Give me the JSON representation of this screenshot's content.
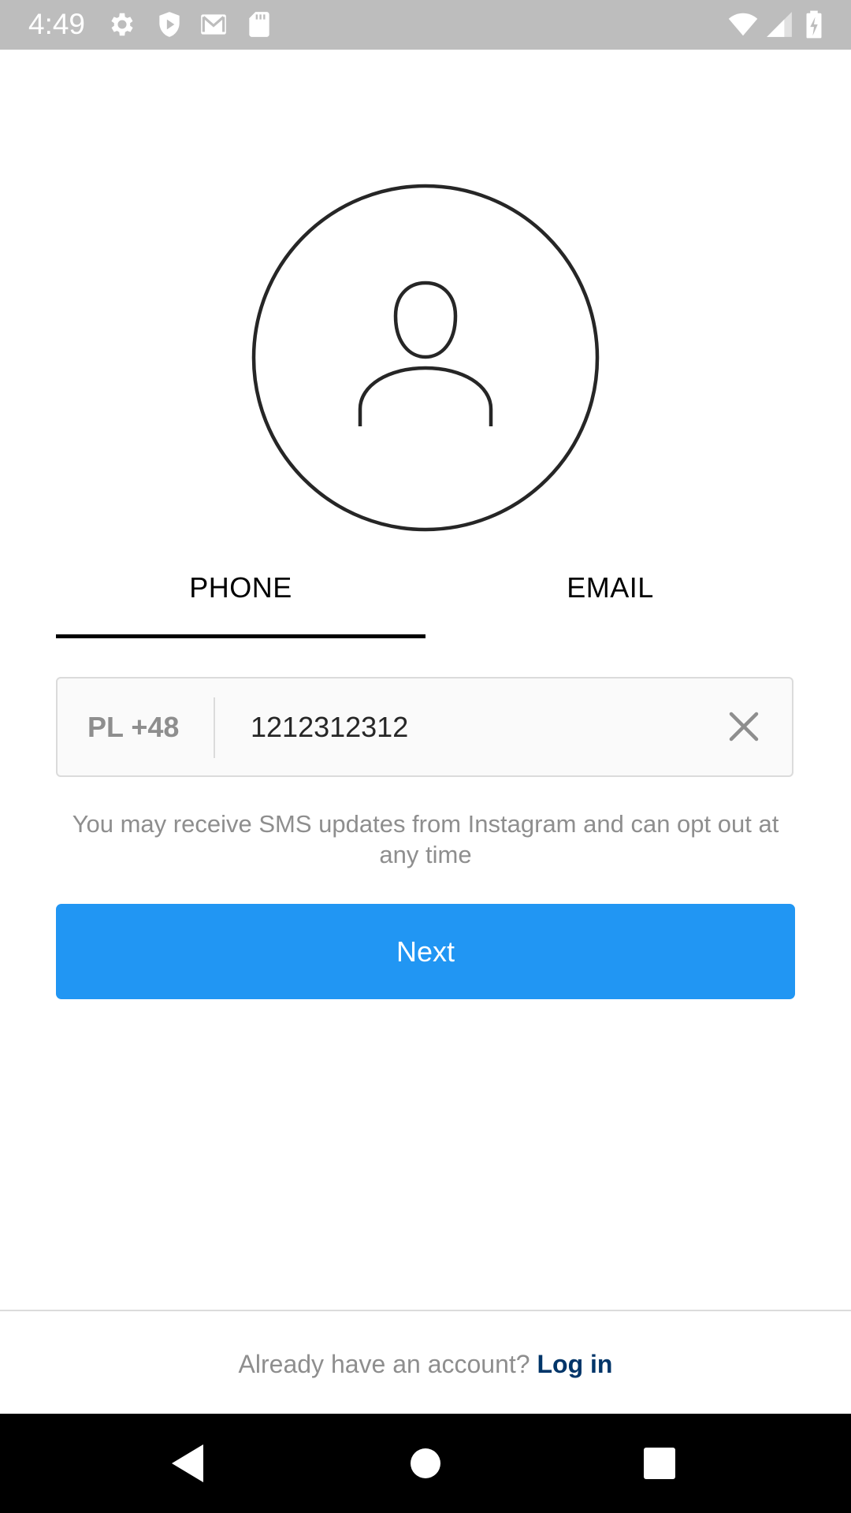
{
  "status_bar": {
    "time": "4:49",
    "icons": [
      "settings-icon",
      "shield-icon",
      "gmail-icon",
      "sd-card-icon",
      "wifi-icon",
      "signal-icon",
      "battery-charging-icon"
    ],
    "background_color": "#bdbdbd"
  },
  "tabs": {
    "phone_label": "PHONE",
    "email_label": "EMAIL",
    "active": "PHONE"
  },
  "phone_field": {
    "country_code": "PL +48",
    "value": "1212312312"
  },
  "sms_note": "You may receive SMS updates from Instagram and can opt out at any time",
  "next_button": {
    "label": "Next",
    "color": "#2196f3"
  },
  "footer": {
    "prompt": "Already have an account?",
    "login_label": "Log in",
    "link_color": "#003569"
  },
  "nav_bar": {
    "buttons": [
      "back-icon",
      "home-icon",
      "recents-icon"
    ]
  }
}
